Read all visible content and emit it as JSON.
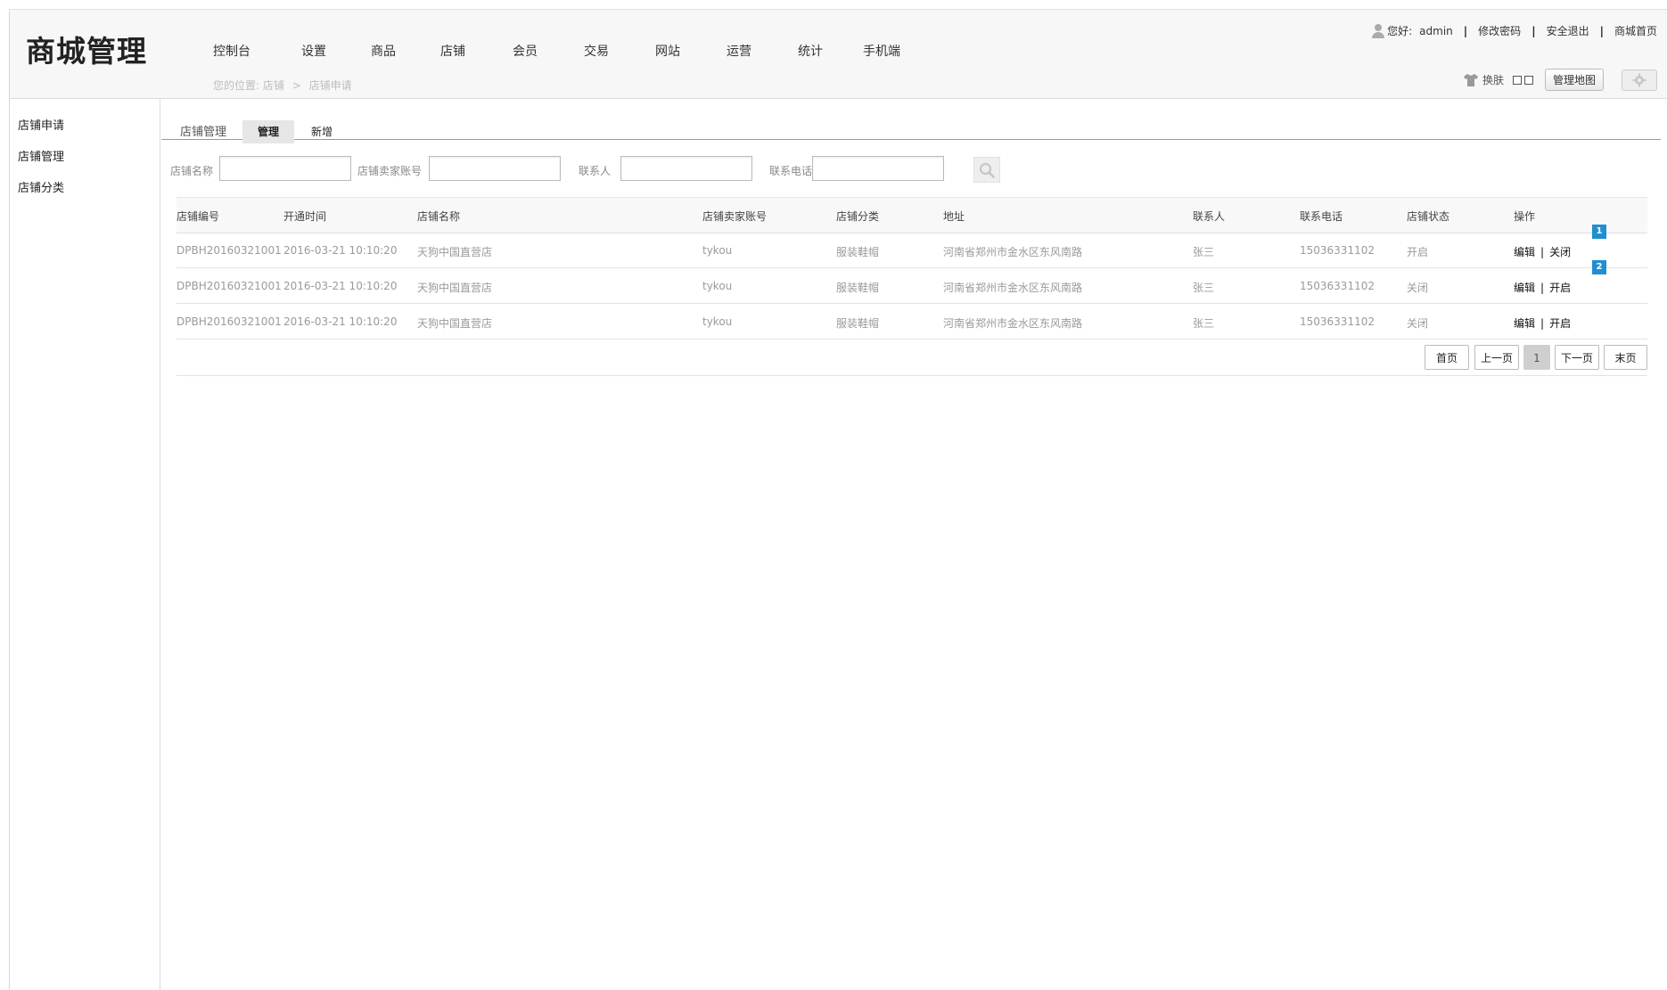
{
  "header": {
    "logo": "商城管理",
    "nav": [
      "控制台",
      "设置",
      "商品",
      "店铺",
      "会员",
      "交易",
      "网站",
      "运营",
      "统计",
      "手机端"
    ],
    "breadcrumb": {
      "prefix": "您的位置:",
      "level1": "店铺",
      "sep": ">",
      "level2": "店铺申请"
    },
    "user": {
      "greeting": "您好:",
      "name": "admin",
      "change_password": "修改密码",
      "logout": "安全退出",
      "home": "商城首页"
    },
    "tools": {
      "skin": "换肤",
      "map_button": "管理地图"
    }
  },
  "sidebar": {
    "items": [
      "店铺申请",
      "店铺管理",
      "店铺分类"
    ]
  },
  "main": {
    "section_title": "店铺管理",
    "tabs": [
      "管理",
      "新增"
    ],
    "filters": {
      "shop_name": "店铺名称",
      "seller_account": "店铺卖家账号",
      "contact": "联系人",
      "phone": "联系电话"
    },
    "table": {
      "columns": [
        "店铺编号",
        "开通时间",
        "店铺名称",
        "店铺卖家账号",
        "店铺分类",
        "地址",
        "联系人",
        "联系电话",
        "店铺状态",
        "操作"
      ],
      "rows": [
        {
          "id": "DPBH20160321001",
          "time": "2016-03-21 10:10:20",
          "name": "天狗中国直营店",
          "account": "tykou",
          "category": "服装鞋帽",
          "address": "河南省郑州市金水区东风南路",
          "contact": "张三",
          "phone": "15036331102",
          "status": "开启",
          "edit": "编辑",
          "toggle": "关闭"
        },
        {
          "id": "DPBH20160321001",
          "time": "2016-03-21 10:10:20",
          "name": "天狗中国直营店",
          "account": "tykou",
          "category": "服装鞋帽",
          "address": "河南省郑州市金水区东风南路",
          "contact": "张三",
          "phone": "15036331102",
          "status": "关闭",
          "edit": "编辑",
          "toggle": "开启"
        },
        {
          "id": "DPBH20160321001",
          "time": "2016-03-21 10:10:20",
          "name": "天狗中国直营店",
          "account": "tykou",
          "category": "服装鞋帽",
          "address": "河南省郑州市金水区东风南路",
          "contact": "张三",
          "phone": "15036331102",
          "status": "关闭",
          "edit": "编辑",
          "toggle": "开启"
        }
      ],
      "badges": [
        "1",
        "2"
      ]
    },
    "pager": {
      "first": "首页",
      "prev": "上一页",
      "current": "1",
      "next": "下一页",
      "last": "末页"
    }
  },
  "colors": {
    "badge": "#1f8fd0",
    "header_bg": "#f7f7f7"
  }
}
